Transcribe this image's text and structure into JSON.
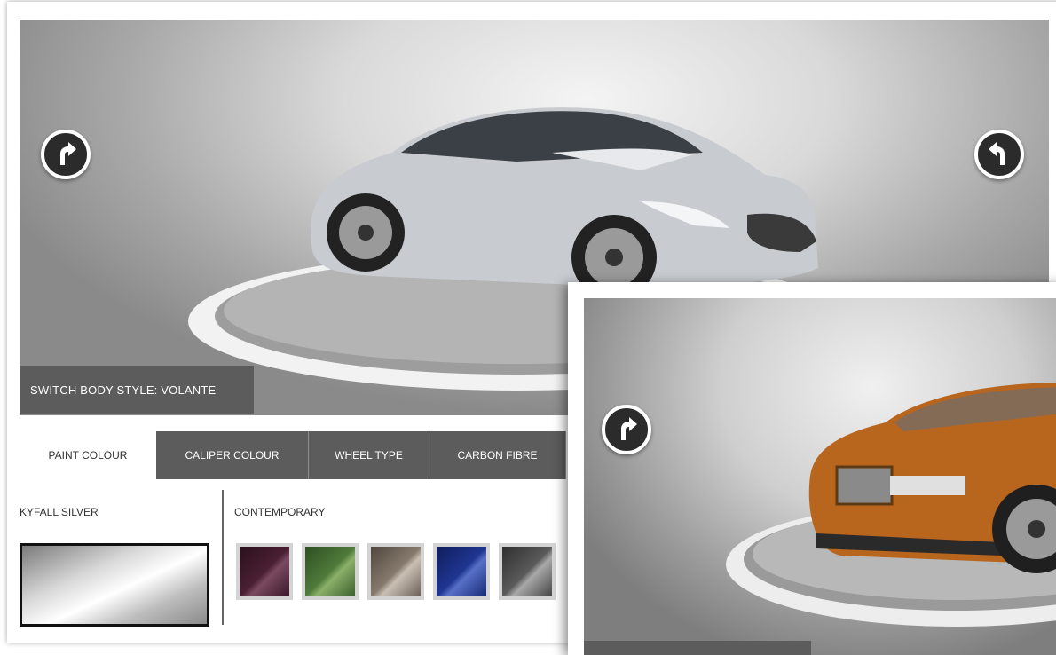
{
  "configurator": {
    "switch_body_style": "SWITCH BODY STYLE: VOLANTE",
    "tabs": [
      {
        "label": "PAINT COLOUR",
        "active": true
      },
      {
        "label": "CALIPER COLOUR",
        "active": false
      },
      {
        "label": "WHEEL TYPE",
        "active": false
      },
      {
        "label": "CARBON FIBRE",
        "active": false
      }
    ],
    "selected_colour": "KYFALL SILVER",
    "colour_group": "CONTEMPORARY",
    "swatches": [
      {
        "name": "plum",
        "color": "#4a1f33"
      },
      {
        "name": "green",
        "color": "#4f7a3a"
      },
      {
        "name": "bronze-grey",
        "color": "#857a6c"
      },
      {
        "name": "blue",
        "color": "#1f3590"
      },
      {
        "name": "graphite",
        "color": "#5a5a5a"
      }
    ],
    "rotate_left_icon": "rotate-left-icon",
    "rotate_right_icon": "rotate-right-icon"
  },
  "colors": {
    "tab_bg": "#5c5c5c",
    "silver_car": "#c8ccd1",
    "orange_car": "#b8651e"
  }
}
